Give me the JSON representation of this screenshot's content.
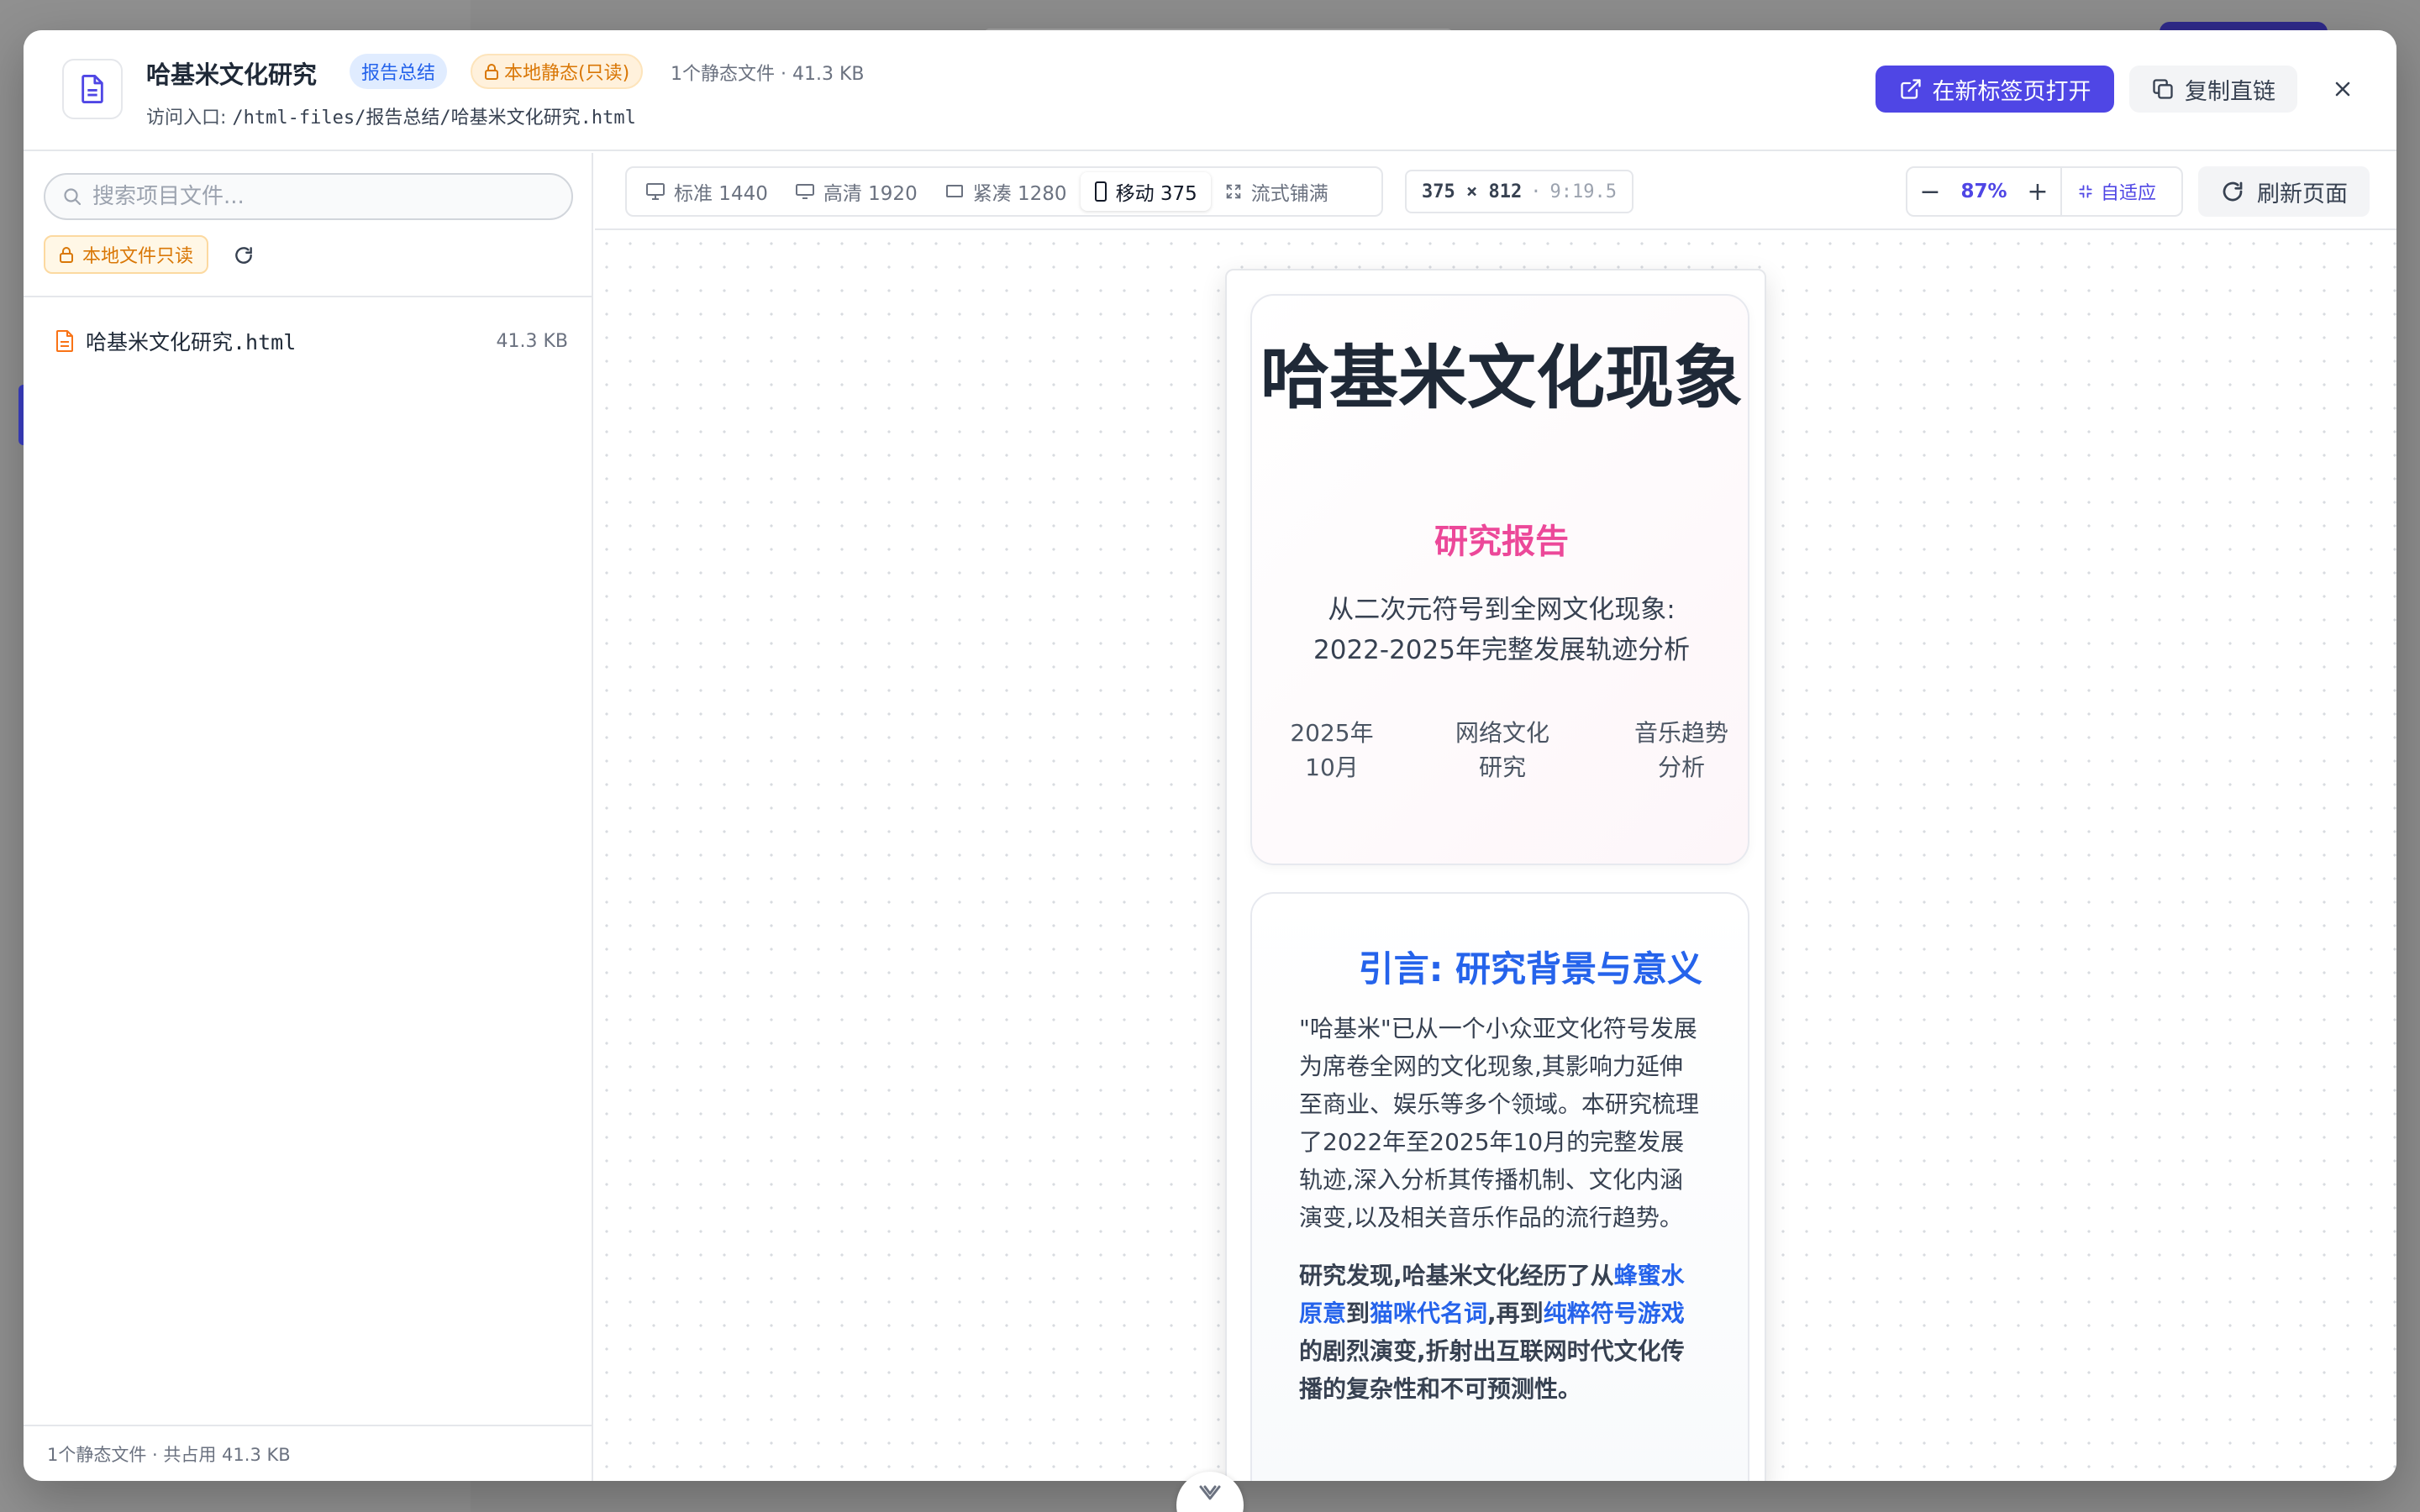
{
  "header": {
    "title": "哈基米文化研究",
    "category_badge": "报告总结",
    "access_badge": "本地静态(只读)",
    "meta": "1个静态文件 · 41.3 KB",
    "entry_label": "访问入口: ",
    "entry_path": "/html-files/报告总结/哈基米文化研究.html",
    "open_new_tab": "在新标签页打开",
    "copy_link": "复制直链"
  },
  "sidebar": {
    "search_placeholder": "搜索项目文件...",
    "readonly_label": "本地文件只读",
    "files": [
      {
        "name": "哈基米文化研究.html",
        "size": "41.3 KB"
      }
    ],
    "footer": "1个静态文件 · 共占用 41.3 KB"
  },
  "toolbar": {
    "viewports": [
      {
        "label": "标准 1440",
        "icon": "desktop-icon"
      },
      {
        "label": "高清 1920",
        "icon": "monitor-icon"
      },
      {
        "label": "紧凑 1280",
        "icon": "laptop-icon"
      },
      {
        "label": "移动 375",
        "icon": "phone-icon",
        "active": true
      },
      {
        "label": "流式铺满",
        "icon": "expand-icon"
      }
    ],
    "dims_size": "375 × 812",
    "dims_sep": "·",
    "dims_ratio": "9:19.5",
    "zoom_minus": "−",
    "zoom_value": "87%",
    "zoom_plus": "+",
    "fit_label": "自适应",
    "reload_label": "刷新页面"
  },
  "preview": {
    "hero_title": "哈基米文化现象",
    "hero_subtitle": "研究报告",
    "hero_desc": "从二次元符号到全网文化现象: 2022-2025年完整发展轨迹分析",
    "hero_meta": [
      "2025年10月",
      "网络文化研究",
      "音乐趋势分析"
    ],
    "intro_heading": "引言: 研究背景与意义",
    "intro_p1": "\"哈基米\"已从一个小众亚文化符号发展为席卷全网的文化现象,其影响力延伸至商业、娱乐等多个领域。本研究梳理了2022年至2025年10月的完整发展轨迹,深入分析其传播机制、文化内涵演变,以及相关音乐作品的流行趋势。",
    "intro_p2": {
      "t1": "研究发现,哈基米文化经历了从",
      "h1": "蜂蜜水原意",
      "t2": "到",
      "h2": "猫咪代名词",
      "t3": ",再到",
      "h3": "纯粹符号游戏",
      "t4": "的剧烈演变,折射出互联网时代文化传播的复杂性和不可预测性。"
    }
  },
  "colors": {
    "primary": "#4f46e5",
    "accent_blue": "#2563eb",
    "accent_pink": "#ec4899",
    "warning": "#d97706"
  }
}
